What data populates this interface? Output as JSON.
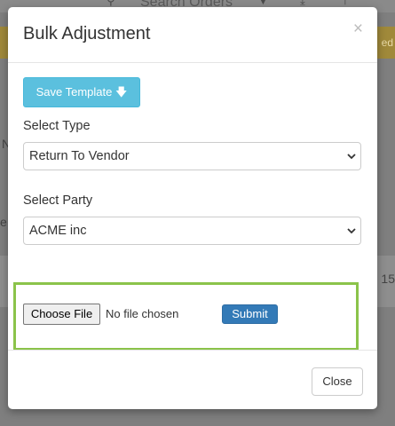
{
  "background": {
    "search_placeholder": "Search Orders",
    "banner_fragment": "ed",
    "number_fragment": "15",
    "left_fragment_1": "N",
    "left_fragment_2": "e"
  },
  "modal": {
    "title": "Bulk Adjustment",
    "close_symbol": "×",
    "save_template_label": "Save Template",
    "save_template_icon": "arrow-down-icon",
    "select_type": {
      "label": "Select Type",
      "value": "Return To Vendor"
    },
    "select_party": {
      "label": "Select Party",
      "value": "ACME inc"
    },
    "upload": {
      "choose_file_label": "Choose File",
      "file_status": "No file chosen",
      "submit_label": "Submit"
    },
    "footer": {
      "close_label": "Close"
    }
  },
  "colors": {
    "info": "#5bc0de",
    "primary": "#337ab7",
    "highlight": "#8bc34a"
  }
}
